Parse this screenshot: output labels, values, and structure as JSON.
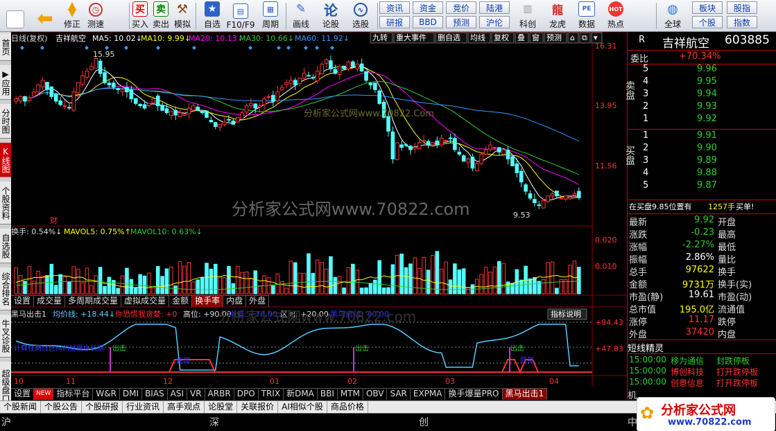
{
  "toolbar": {
    "items": [
      "修正",
      "测速",
      "买入",
      "卖出",
      "模拟",
      "自选",
      "F10/F9",
      "周期",
      "画线",
      "论股",
      "选股"
    ],
    "small_buttons": [
      "资讯",
      "资金",
      "竞价",
      "陆港",
      "研报",
      "BBD",
      "预测",
      "沪伦",
      "科创",
      "龙虎",
      "数据",
      "热点",
      "全球",
      "板块",
      "股指",
      "个股",
      "指数"
    ]
  },
  "lefttabs": [
    "首页",
    "应用",
    "分时图",
    "K线图",
    "个股资料",
    "自选股",
    "综合排名",
    "牛叉诊股",
    "超级盘口"
  ],
  "kline": {
    "header": [
      "日线(复权)",
      "吉祥航空",
      "MA5: 10.02↓",
      "MA10: 9.99↓",
      "MA20: 10.13↓",
      "MA30: 10.66↓",
      "MA60: 11.92↓"
    ],
    "top_buttons": [
      "九转",
      "重大事件",
      "删自选",
      "均线",
      "复权",
      "叠",
      "窗",
      "预测"
    ],
    "yticks": [
      "16.31",
      "13.95",
      "11.56"
    ],
    "hi_label": "15.95",
    "lo_label": "9.53",
    "cai_label": "财",
    "watermark1": "分析家公式网www.70822.Com",
    "watermark2": "分析家公式网www.70822.com"
  },
  "volume": {
    "header": [
      "换手: 0.54%↓",
      "MAVOL5: 0.75%↑",
      "MAVOL10: 0.63%↓"
    ],
    "yticks": [
      "0.020",
      "0.010"
    ]
  },
  "tabs1": [
    "设置",
    "成交量",
    "多周期成交量",
    "虚拟成交量",
    "金额",
    "换手率",
    "内盘",
    "外盘"
  ],
  "indicator": {
    "header": [
      "黑马出击1",
      "均价线: +18.44↓",
      "你恐慌我贪婪: +0",
      "高位: +90.00",
      "中值: +70.00",
      "区间: +20.00",
      "黑马启动: +0.00"
    ],
    "explain": "指标说明",
    "yticks": [
      "+94.43",
      "+47.83"
    ],
    "annots": [
      "计算在两线区间的就是中长期",
      "出击",
      "底部",
      "出击",
      "出击",
      "底部"
    ],
    "watermark": "分析家公式网www.70822.com"
  },
  "xaxis": [
    "10",
    "11",
    "12",
    "01",
    "02",
    "03",
    "04"
  ],
  "tabs2": [
    "设置",
    "NEW",
    "指标平台",
    "W&R",
    "DMI",
    "BIAS",
    "ASI",
    "VR",
    "ARBR",
    "DPO",
    "TRIX",
    "新DMA",
    "BBI",
    "MTM",
    "OBV",
    "SAR",
    "EXPMA",
    "换手爆量PRO",
    "黑马出击1"
  ],
  "bottombar": [
    "个股新闻",
    "个股公告",
    "个股研报",
    "行业资讯",
    "高手观点",
    "论股堂",
    "关联报价",
    "AI相似个股",
    "商品价格"
  ],
  "status": [
    "沪",
    "深",
    "创",
    "中"
  ],
  "quote": {
    "r_label": "R",
    "name": "吉祥航空",
    "code": "603885",
    "weibi_label": "委比",
    "weibi": "+70.34%",
    "sell_label": "卖盘",
    "buy_label": "买盘",
    "sells": [
      {
        "n": "5",
        "p": "9.96"
      },
      {
        "n": "4",
        "p": "9.95"
      },
      {
        "n": "3",
        "p": "9.94"
      },
      {
        "n": "2",
        "p": "9.93"
      },
      {
        "n": "1",
        "p": "9.92"
      }
    ],
    "buys": [
      {
        "n": "1",
        "p": "9.91"
      },
      {
        "n": "2",
        "p": "9.90"
      },
      {
        "n": "3",
        "p": "9.89"
      },
      {
        "n": "4",
        "p": "9.88"
      },
      {
        "n": "5",
        "p": "9.87"
      }
    ],
    "notice": "在买盘9.85位置有",
    "notice_vol": "1257手",
    "notice_tag": "买单!",
    "fields": [
      {
        "l": "最新",
        "v": "9.92",
        "r": "开盘",
        "c": "#3c3"
      },
      {
        "l": "涨跌",
        "v": "-0.23",
        "r": "最高",
        "c": "#3c3"
      },
      {
        "l": "涨幅",
        "v": "-2.27%",
        "r": "最低",
        "c": "#3c3"
      },
      {
        "l": "振幅",
        "v": "2.86%",
        "r": "量比",
        "c": "#fff"
      },
      {
        "l": "总手",
        "v": "97622",
        "r": "换手",
        "c": "#ff0"
      },
      {
        "l": "金额",
        "v": "9731万",
        "r": "换手(实)",
        "c": "#ff0"
      },
      {
        "l": "市盈(静)",
        "v": "19.61",
        "r": "市盈(动)",
        "c": "#fff"
      },
      {
        "l": "总市值",
        "v": "195.0亿",
        "r": "流通值",
        "c": "#ff0"
      },
      {
        "l": "涨停",
        "v": "11.17",
        "r": "跌停",
        "c": "#f33"
      },
      {
        "l": "外盘",
        "v": "37420",
        "r": "内盘",
        "c": "#f33"
      }
    ],
    "jl_title": "短线精灵",
    "jl": [
      {
        "t": "15:00:00",
        "n": "移为通信",
        "e": "封跌停板",
        "c": "#3c3"
      },
      {
        "t": "15:00:00",
        "n": "博创科技",
        "e": "打开跌停板",
        "c": "#f33"
      },
      {
        "t": "15:00:00",
        "n": "创意信息",
        "e": "打开跌停板",
        "c": "#f33"
      }
    ],
    "bottom_cut": "机",
    "logo": "分析家公式网",
    "logo_url": "www.70822.com"
  },
  "chart_data": {
    "type": "candlestick",
    "title": "吉祥航空 日线(复权)",
    "price_range": [
      9.0,
      16.5
    ],
    "closes": [
      14.2,
      14.3,
      14.1,
      14.25,
      14.5,
      14.8,
      15.0,
      14.6,
      14.3,
      14.1,
      13.95,
      13.9,
      13.8,
      14.5,
      14.9,
      15.2,
      15.4,
      15.6,
      15.95,
      15.3,
      14.9,
      14.8,
      14.7,
      14.6,
      14.6,
      14.5,
      14.2,
      14.0,
      13.9,
      13.8,
      14.0,
      14.2,
      13.9,
      13.7,
      13.6,
      13.65,
      13.5,
      13.6,
      13.55,
      13.8,
      13.9,
      13.7,
      13.6,
      13.4,
      13.2,
      13.0,
      13.1,
      13.2,
      13.3,
      13.1,
      13.4,
      13.6,
      13.9,
      14.0,
      13.8,
      13.9,
      14.2,
      14.3,
      14.1,
      14.5,
      14.7,
      14.9,
      15.0,
      14.8,
      15.1,
      15.3,
      15.2,
      15.1,
      15.4,
      15.7,
      15.9,
      15.5,
      15.3,
      15.6,
      15.5,
      15.8,
      15.6,
      15.7,
      15.4,
      15.0,
      14.8,
      14.6,
      14.0,
      13.4,
      12.8,
      11.6,
      12.3,
      12.1,
      12.2,
      12.0,
      12.1,
      12.3,
      12.4,
      12.2,
      12.3,
      12.2,
      12.5,
      12.4,
      12.5,
      12.0,
      11.8,
      11.5,
      11.6,
      11.2,
      11.4,
      11.8,
      12.0,
      12.2,
      12.1,
      11.9,
      12.0,
      11.6,
      11.3,
      11.0,
      10.6,
      10.2,
      9.9,
      9.7,
      9.6,
      9.8,
      10.0,
      10.1,
      10.0,
      9.9,
      10.0,
      9.95,
      10.1,
      9.92
    ]
  }
}
